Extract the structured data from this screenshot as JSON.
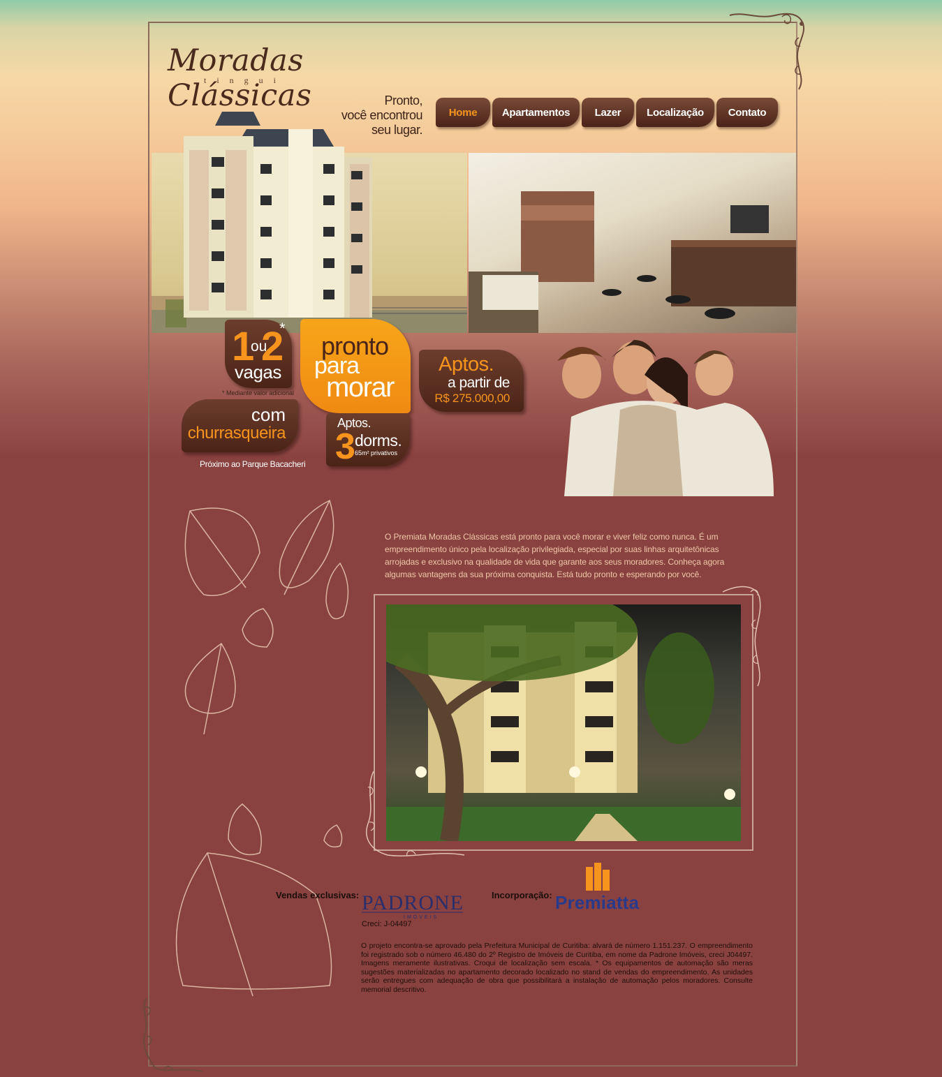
{
  "logo": {
    "title": "Moradas Clássicas",
    "subtitle": "tingui"
  },
  "tagline": [
    "Pronto,",
    "você encontrou",
    "seu lugar."
  ],
  "nav": [
    {
      "label": "Home",
      "active": true
    },
    {
      "label": "Apartamentos",
      "active": false
    },
    {
      "label": "Lazer",
      "active": false
    },
    {
      "label": "Localização",
      "active": false
    },
    {
      "label": "Contato",
      "active": false
    }
  ],
  "badges": {
    "vagas": {
      "n1": "1",
      "ou": "ou",
      "n2": "2",
      "ast": "*",
      "label": "vagas",
      "note": "* Mediante valor adicional"
    },
    "churras": {
      "l1": "com",
      "l2": "churrasqueira"
    },
    "pronto": {
      "l1": "pronto",
      "l2": "para",
      "l3": "morar"
    },
    "dorms": {
      "aptos": "Aptos.",
      "n": "3",
      "dorms": "dorms.",
      "area": "65m² privativos"
    },
    "price": {
      "a": "Aptos.",
      "b": "a partir de",
      "c": "R$ 275.000,00"
    },
    "location": "Próximo ao Parque Bacacheri"
  },
  "intro": "O Premiata Moradas Clássicas está pronto para você morar e viver feliz como nunca. É um empreendimento único pela localização privilegiada, especial por suas linhas arquitetônicas arrojadas e exclusivo na qualidade de vida que garante aos seus moradores. Conheça agora algumas vantagens da sua próxima conquista. Está tudo pronto e esperando por você.",
  "footer": {
    "sales_label": "Vendas exclusivas:",
    "padrone_name": "PADRONE",
    "padrone_sub": "IMÓVEIS",
    "creci": "Creci: J-04497",
    "inc_label": "Incorporação:",
    "premiatta": "Premiatta",
    "legal": "O projeto encontra-se aprovado pela Prefeitura Municipal de Curitiba: alvará de número 1.151.237. O empreendimento foi registrado sob o número 46.480 do 2º Registro de Imóveis de Curitiba, em nome da Padrone Imóveis, creci J04497. Imagens meramente ilustrativas. Croqui de localização sem escala. * Os equipamentos de automação são meras sugestões materializadas no apartamento decorado localizado no stand de vendas do empreendimento. As unidades serão entregues com adequação de obra que possibilitará a instalação de automação pelos moradores. Consulte memorial descritivo."
  },
  "colors": {
    "accent": "#f7941d",
    "brown": "#4b2417",
    "background": "#8a4241"
  }
}
